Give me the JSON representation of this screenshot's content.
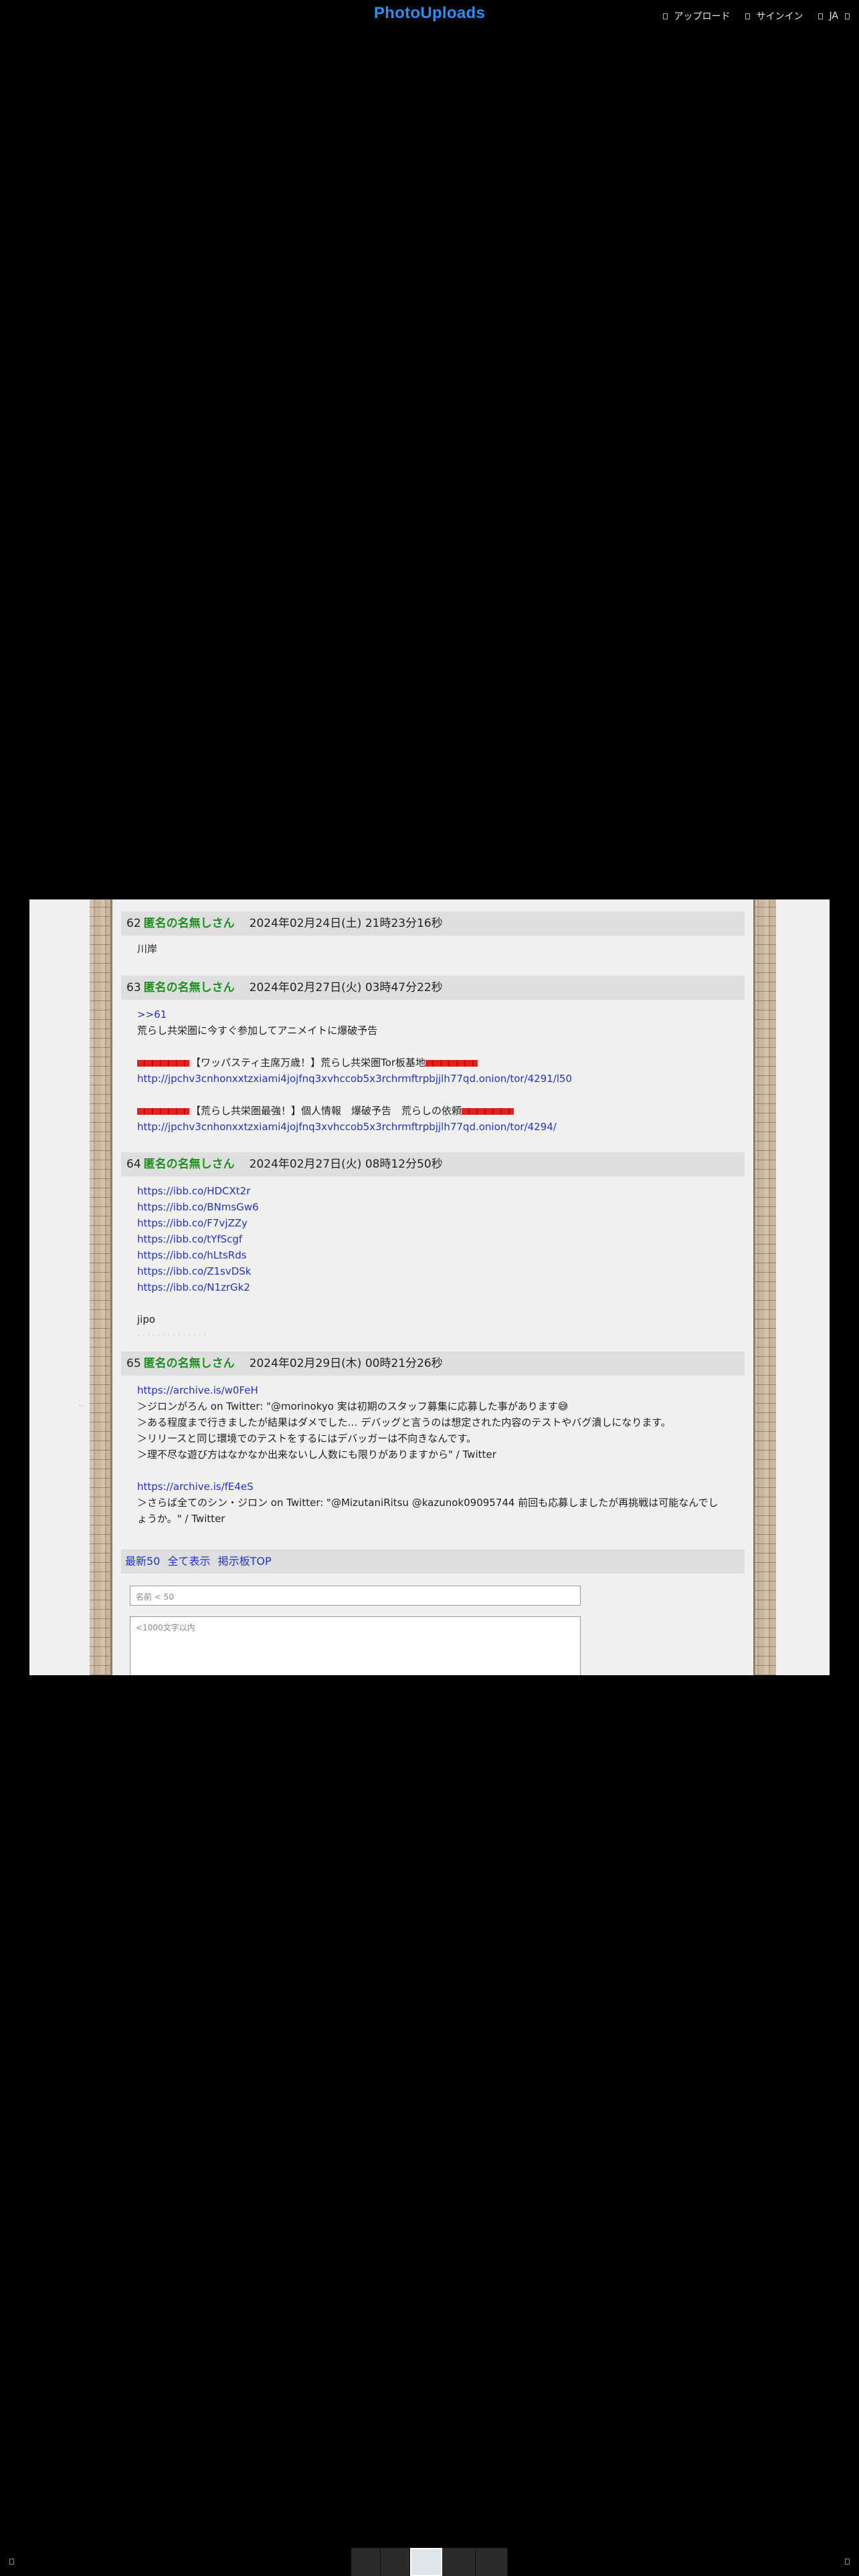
{
  "header": {
    "logo": "PhotoUploads",
    "nav": [
      {
        "label": "アップロード",
        "icon": "upload-icon"
      },
      {
        "label": "サインイン",
        "icon": "sign-in-icon"
      },
      {
        "label": "JA",
        "icon": "language-icon"
      }
    ]
  },
  "posts": [
    {
      "num": "62",
      "name": "匿名の名無しさん",
      "date": "2024年02月24日(土) 21時23分16秒",
      "lines": [
        {
          "type": "text",
          "text": "川岸"
        }
      ]
    },
    {
      "num": "63",
      "name": "匿名の名無しさん",
      "date": "2024年02月27日(火) 03時47分22秒",
      "lines": [
        {
          "type": "link",
          "text": ">>61"
        },
        {
          "type": "text",
          "text": "荒らし共栄圏に今すぐ参加してアニメイトに爆破予告"
        },
        {
          "type": "blank",
          "text": ""
        },
        {
          "type": "text",
          "text": "【ワッパスティ主席万歳！】荒らし共栄圏Tor板基地"
        },
        {
          "type": "link",
          "text": "http://jpchv3cnhonxxtzxiami4jojfnq3xvhccob5x3rchrmftrpbjjlh77qd.onion/tor/4291/l50"
        },
        {
          "type": "blank",
          "text": ""
        },
        {
          "type": "text",
          "text": "【荒らし共栄圏最強！】個人情報　爆破予告　荒らしの依頼"
        },
        {
          "type": "link",
          "text": "http://jpchv3cnhonxxtzxiami4jojfnq3xvhccob5x3rchrmftrpbjjlh77qd.onion/tor/4294/"
        }
      ]
    },
    {
      "num": "64",
      "name": "匿名の名無しさん",
      "date": "2024年02月27日(火) 08時12分50秒",
      "lines": [
        {
          "type": "link",
          "text": "https://ibb.co/HDCXt2r"
        },
        {
          "type": "link",
          "text": "https://ibb.co/BNmsGw6"
        },
        {
          "type": "link",
          "text": "https://ibb.co/F7vjZZy"
        },
        {
          "type": "link",
          "text": "https://ibb.co/tYfScgf"
        },
        {
          "type": "link",
          "text": "https://ibb.co/hLtsRds"
        },
        {
          "type": "link",
          "text": "https://ibb.co/Z1svDSk"
        },
        {
          "type": "link",
          "text": "https://ibb.co/N1zrGk2"
        },
        {
          "type": "blank",
          "text": ""
        },
        {
          "type": "text",
          "text": "jipo"
        }
      ]
    },
    {
      "num": "65",
      "name": "匿名の名無しさん",
      "date": "2024年02月29日(木) 00時21分26秒",
      "lines": [
        {
          "type": "link",
          "text": "https://archive.is/w0FeH"
        },
        {
          "type": "text",
          "text": "＞ジロンがろん on Twitter: \"@morinokyo 実は初期のスタッフ募集に応募した事があります😅"
        },
        {
          "type": "text",
          "text": "＞ある程度まで行きましたが結果はダメでした… デバッグと言うのは想定された内容のテストやバグ潰しになります。"
        },
        {
          "type": "text",
          "text": "＞リリースと同じ環境でのテストをするにはデバッガーは不向きなんです。"
        },
        {
          "type": "text",
          "text": "＞理不尽な遊び方はなかなか出来ないし人数にも限りがありますから\" / Twitter"
        },
        {
          "type": "blank",
          "text": ""
        },
        {
          "type": "link",
          "text": "https://archive.is/fE4eS"
        },
        {
          "type": "text",
          "text": "＞さらば全てのシン・ジロン on Twitter: \"@MizutaniRitsu @kazunok09095744 前回も応募しましたが再挑戦は可能なんでし"
        },
        {
          "type": "text",
          "text": "ょうか。\" / Twitter"
        }
      ]
    }
  ],
  "footer": {
    "latest50": "最新50",
    "show_all": "全て表示",
    "board_top": "掲示板TOP",
    "name_placeholder": "名前 < 50",
    "message_placeholder": "<1000文字以内"
  }
}
